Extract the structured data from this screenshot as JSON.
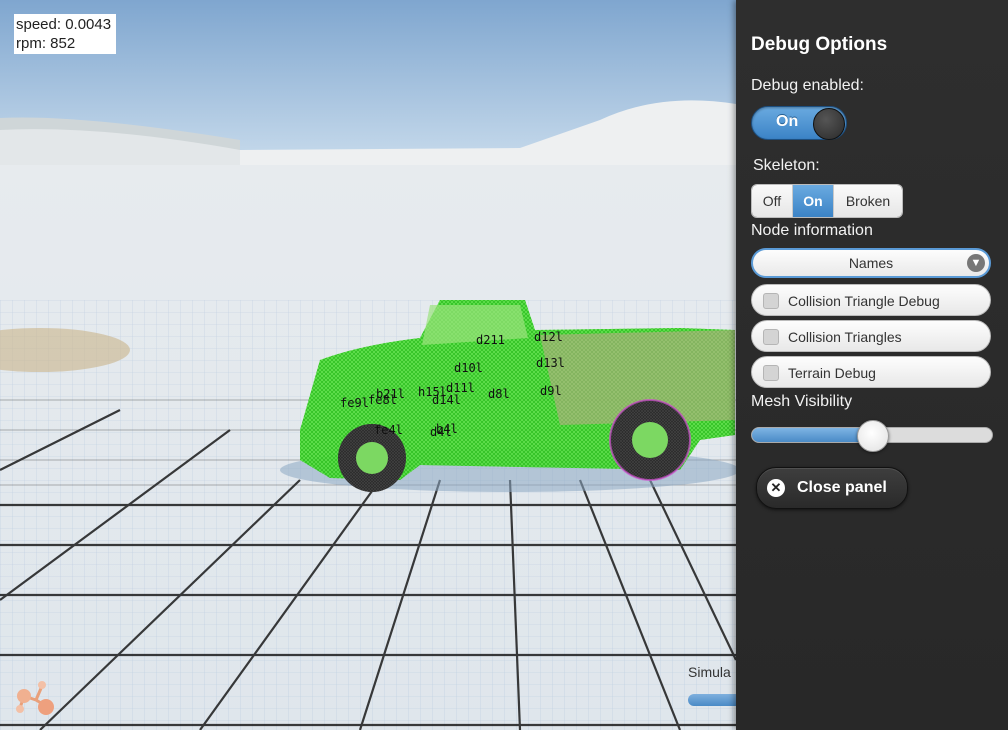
{
  "hud": {
    "speed_label": "speed: 0.0043",
    "rpm_label": "rpm: 852"
  },
  "bottom": {
    "sim_label": "Simula"
  },
  "node_labels": [
    "d211",
    "d12l",
    "d10l",
    "d13l",
    "b21l",
    "h15l",
    "d11l",
    "d8l",
    "d9l",
    "fe9l",
    "fe8l",
    "d14l",
    "fe4l",
    "d4l",
    "b4l"
  ],
  "debug_panel": {
    "title": "Debug Options",
    "debug_enabled_label": "Debug enabled:",
    "debug_toggle": "On",
    "skeleton_label": "Skeleton:",
    "skeleton_options": [
      "Off",
      "On",
      "Broken"
    ],
    "skeleton_selected": "On",
    "node_info_label": "Node information",
    "node_info_value": "Names",
    "checkboxes": [
      "Collision Triangle Debug",
      "Collision Triangles",
      "Terrain Debug"
    ],
    "mesh_visibility_label": "Mesh Visibility",
    "mesh_visibility_value": 0.5,
    "close_label": "Close panel"
  },
  "colors": {
    "accent": "#4a8ac6",
    "panel_bg": "#2b2b2b",
    "vehicle_wire": "#39e62a"
  },
  "icons": {
    "dropdown": "chevron-down-icon",
    "close": "close-icon",
    "logo": "molecule-logo-icon"
  }
}
